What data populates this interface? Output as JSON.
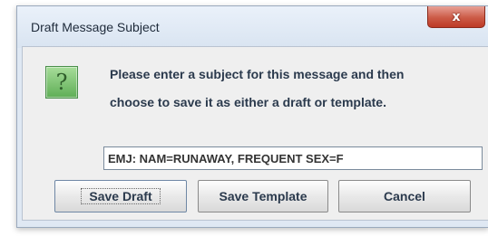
{
  "dialog": {
    "title": "Draft Message Subject",
    "close_glyph": "x",
    "icon": "question-mark-icon",
    "prompt_line_1": "Please enter a subject for this message and then",
    "prompt_line_2": "choose to save it as either a draft or template.",
    "subject_value": "EMJ: NAM=RUNAWAY, FREQUENT SEX=F",
    "buttons": {
      "save_draft": "Save Draft",
      "save_template": "Save Template",
      "cancel": "Cancel"
    }
  },
  "colors": {
    "close_button": "#cc5b47",
    "icon_green": "#5fae56",
    "text": "#2b3a4d"
  }
}
